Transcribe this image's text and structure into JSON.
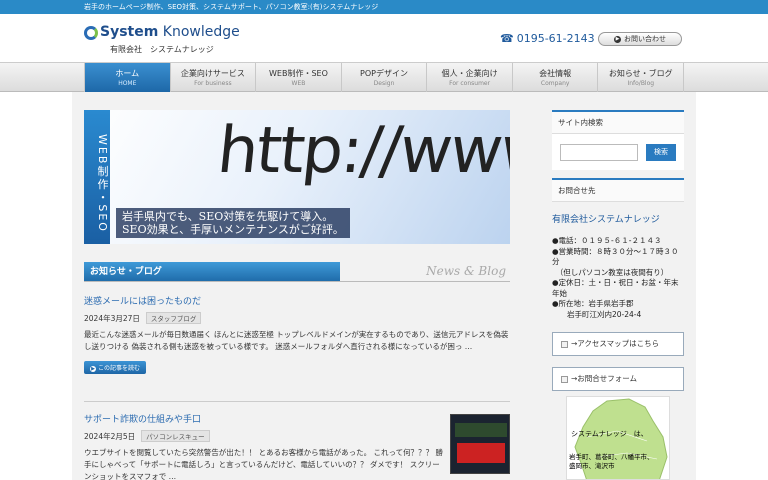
{
  "topbar": {
    "text": "岩手のホームページ制作、SEO対策、システムサポート、パソコン教室:(有)システムナレッジ"
  },
  "header": {
    "logo_brand": "System",
    "logo_word": "Knowledge",
    "logo_sub": "有限会社　システムナレッジ",
    "phone": "0195-61-2143",
    "contact_label": "お問い合わせ"
  },
  "nav": [
    {
      "jp": "ホーム",
      "en": "HOME"
    },
    {
      "jp": "企業向けサービス",
      "en": "For business"
    },
    {
      "jp": "WEB制作・SEO",
      "en": "WEB"
    },
    {
      "jp": "POPデザイン",
      "en": "Design"
    },
    {
      "jp": "個人・企業向け",
      "en": "For consumer"
    },
    {
      "jp": "会社情報",
      "en": "Company"
    },
    {
      "jp": "お知らせ・ブログ",
      "en": "Info/Blog"
    }
  ],
  "banner": {
    "side": "WEB制作・SEO",
    "url": "http://www",
    "copy_line1": "岩手県内でも、SEO対策を先駆けて導入。",
    "copy_line2": "SEO効果と、手厚いメンテナンスがご好評。"
  },
  "news": {
    "heading": "お知らせ・ブログ",
    "heading_en": "News & Blog",
    "posts": [
      {
        "title": "迷惑メールには困ったものだ",
        "date": "2024年3月27日",
        "tag": "スタッフブログ",
        "body": "最近こんな迷惑メールが毎日数通届く ほんとに迷惑至極 トップレベルドメインが実在するものであり、送信元アドレスを偽装し送りつける 偽装される側も迷惑を被っている様です。 迷惑メールフォルダへ直行される様になっているが困っ …",
        "more": "この記事を読む"
      },
      {
        "title": "サポート詐欺の仕組みや手口",
        "date": "2024年2月5日",
        "tag": "パソコンレスキュー",
        "body": "ウエブサイトを閲覧していたら突然警告が出た！！ とあるお客様から電話があった。 これって何？？？ 勝手にしゃべって「サポートに電話しろ」と言っているんだけど、電話していいの？？ ダメです！ スクリーンショットをスマフォで …"
      }
    ]
  },
  "sidebar": {
    "search_heading": "サイト内検索",
    "search_button": "検索",
    "contact_heading": "お問合せ先",
    "company_name": "有限会社システムナレッジ",
    "info_lines": [
      "●電話：０１９５-６１-２１４３",
      "●営業時間：８時３０分～１７時３０分",
      "　（但しパソコン教室は夜間有り）",
      "●定休日：土・日・祝日・お盆・年末年始",
      "●所在地：岩手県岩手郡",
      "　　岩手町江刈内20-24-4"
    ],
    "access_link": "→アクセスマップはこちら",
    "form_link": "→お問合せフォーム",
    "map_label": "システムナレッジ　は、",
    "map_cities_1": "岩手町、葛巻町、八幡平市、",
    "map_cities_2": "盛岡市、滝沢市"
  }
}
